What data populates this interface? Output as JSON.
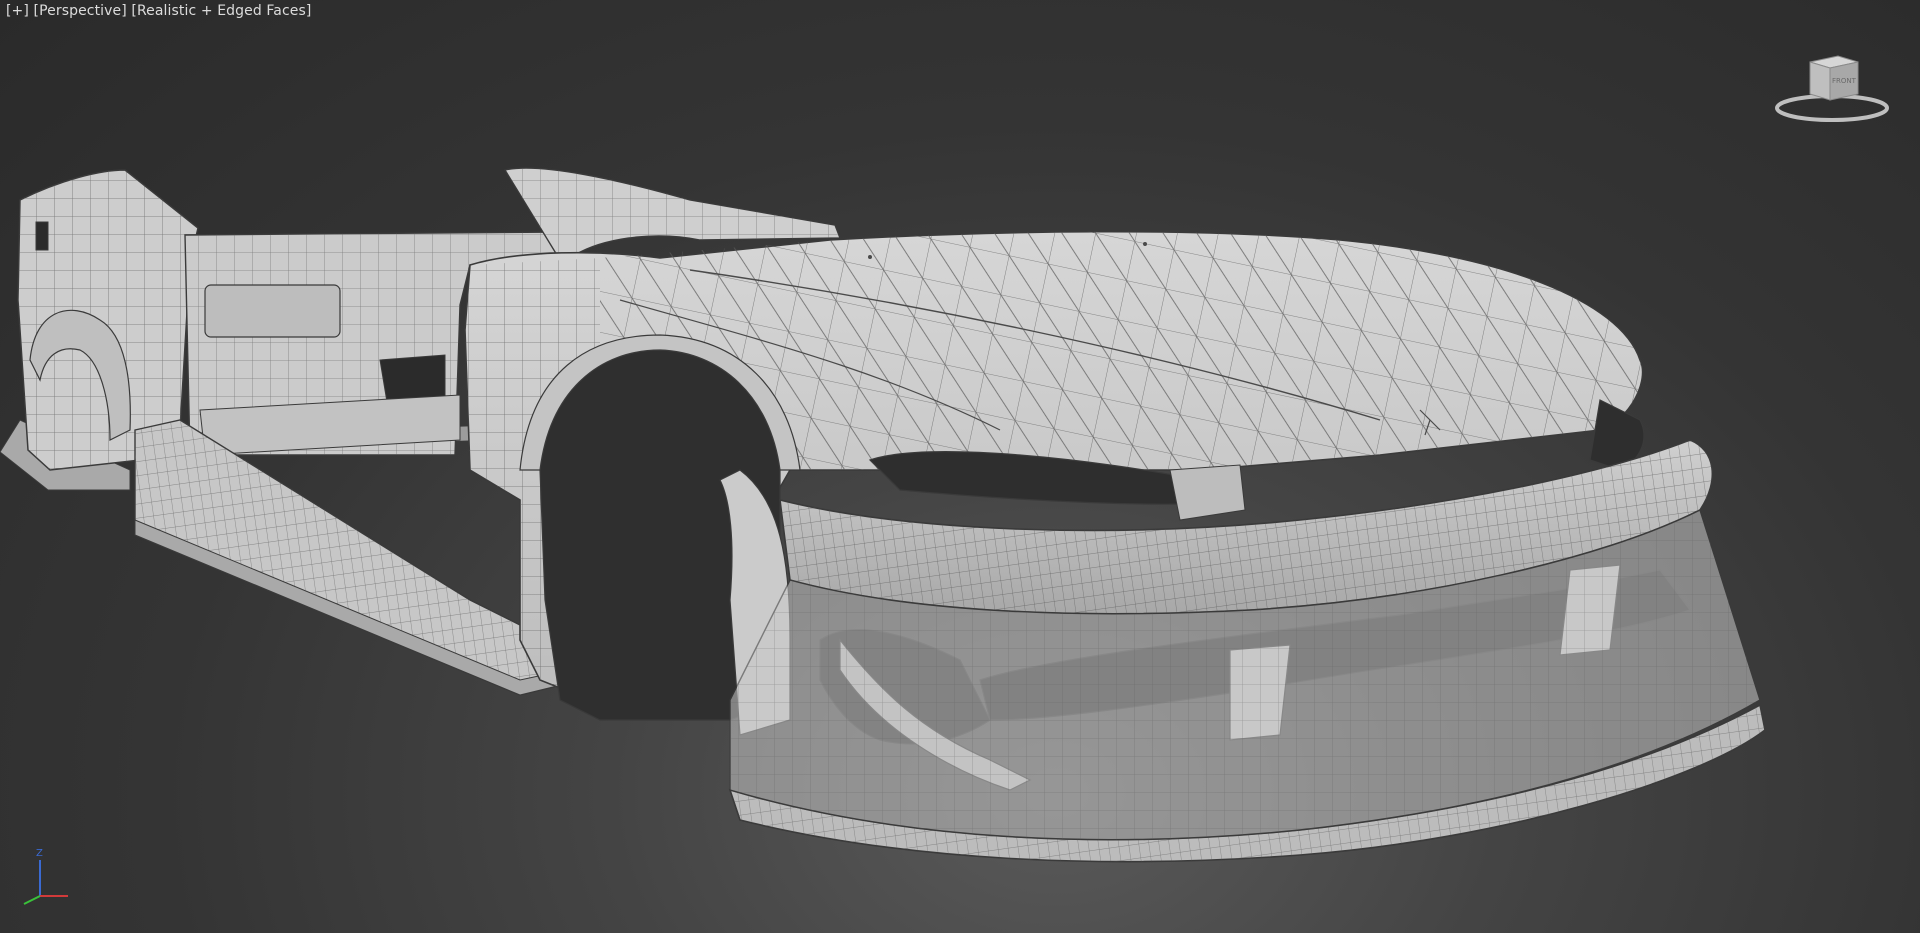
{
  "viewport": {
    "plus_menu": "[+]",
    "point_of_view": "[Perspective]",
    "shading_mode": "[Realistic + Edged Faces]"
  },
  "viewcube": {
    "face_label": "FRONT"
  },
  "axis_tripod": {
    "z_label": "Z"
  },
  "colors": {
    "mesh_fill": "#cfcfcf",
    "mesh_edge": "#3a3a3a",
    "background": "#2b2b2b",
    "axis_x": "#d23a3a",
    "axis_y": "#3ac23a",
    "axis_z": "#3a6ad2"
  }
}
